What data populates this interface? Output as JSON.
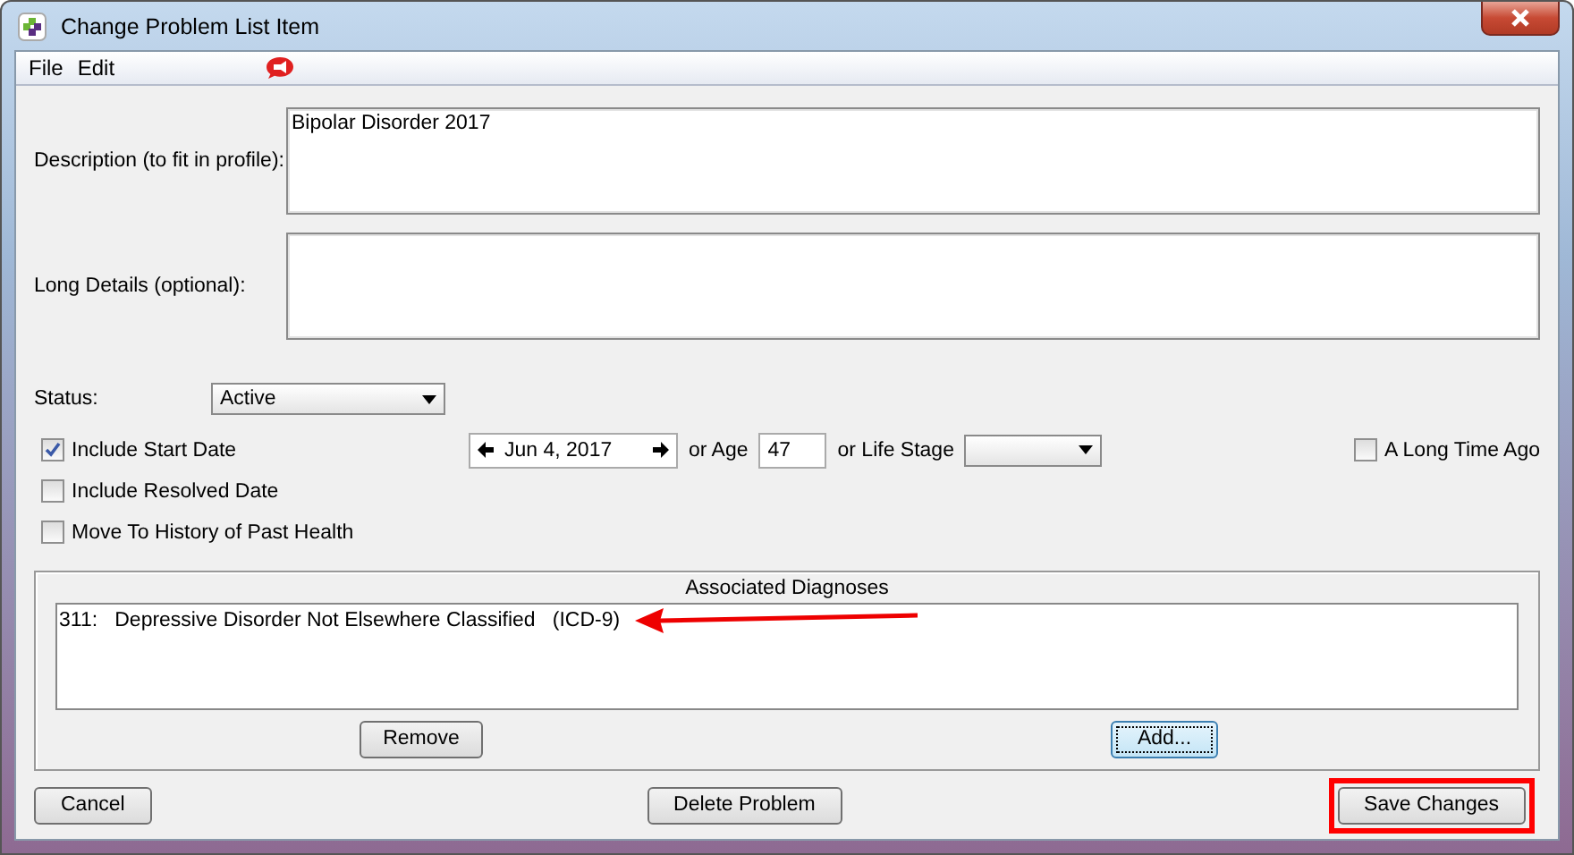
{
  "window": {
    "title": "Change Problem List Item"
  },
  "menu": [
    "File",
    "Edit"
  ],
  "description": {
    "label": "Description (to fit in profile):",
    "value": "Bipolar Disorder 2017"
  },
  "long_details": {
    "label": "Long Details (optional):"
  },
  "status": {
    "label": "Status:",
    "value": "Active"
  },
  "options": [
    {
      "label": "Include Start Date",
      "checked": true
    },
    {
      "label": "Include Resolved Date",
      "checked": false
    },
    {
      "label": "Move To History of Past Health",
      "checked": false
    }
  ],
  "start_date": {
    "date": "Jun 4, 2017",
    "age_label": "or Age",
    "age": "47",
    "life_stage_label": "or Life Stage",
    "long_time_ago": {
      "label": "A Long Time Ago",
      "checked": false
    }
  },
  "diagnoses": {
    "title": "Associated Diagnoses",
    "items": [
      {
        "code": "311:",
        "text": "Depressive Disorder Not Elsewhere Classified   (ICD-9)"
      }
    ],
    "buttons": [
      {
        "label": "Remove",
        "focused": false
      },
      {
        "label": "Add...",
        "focused": true
      }
    ]
  },
  "buttons": [
    {
      "label": "Cancel",
      "highlighted": false
    },
    {
      "label": "Delete Problem",
      "highlighted": false
    },
    {
      "label": "Save Changes",
      "highlighted": true
    }
  ]
}
